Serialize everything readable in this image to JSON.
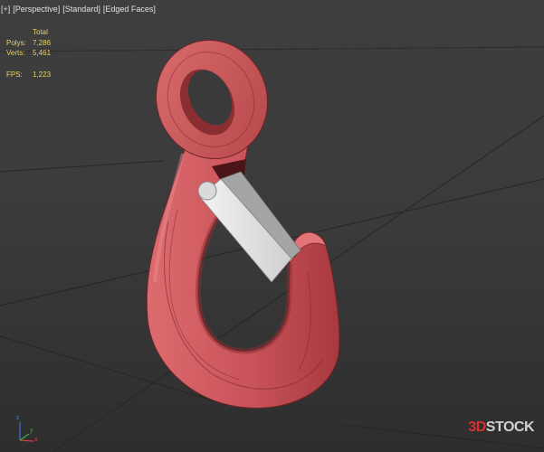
{
  "viewport": {
    "labels": [
      "[+]",
      "[Perspective]",
      "[Standard]",
      "[Edged Faces]"
    ]
  },
  "stats": {
    "header": "Total",
    "polys": {
      "label": "Polys:",
      "value": "7,286"
    },
    "verts": {
      "label": "Verts:",
      "value": "5,461"
    },
    "fps": {
      "label": "FPS:",
      "value": "1,223"
    }
  },
  "gizmo": {
    "x": "x",
    "y": "y",
    "z": "z"
  },
  "watermark": {
    "prefix": "3D",
    "suffix": "STOCK"
  },
  "colors": {
    "label_text": "#e0e0e0",
    "stats_text": "#e8d26a",
    "hook_red": "#c94f52",
    "latch": "#e6e6e6",
    "axis_x": "#d04040",
    "axis_y": "#40b040",
    "axis_z": "#4070e0",
    "watermark_3d": "#d6302f",
    "watermark_stock": "#d0d0d0"
  }
}
